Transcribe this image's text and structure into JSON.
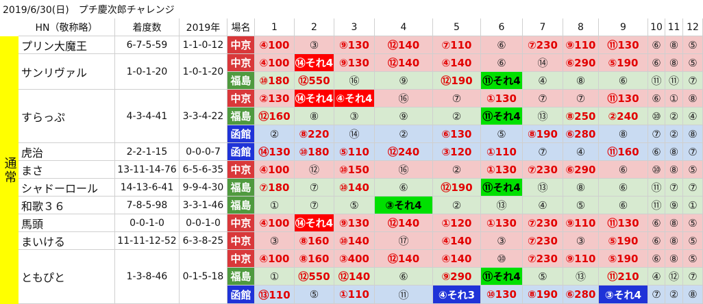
{
  "title": "2019/6/30(日)　プチ慶次郎チャレンジ",
  "group_label": "通常",
  "headers": {
    "hn": "HN（敬称略）",
    "record": "着度数",
    "year": "2019年",
    "venue": "場名",
    "races": [
      "1",
      "2",
      "3",
      "4",
      "5",
      "6",
      "7",
      "8",
      "9",
      "10",
      "11",
      "12"
    ]
  },
  "colors": {
    "chukyo": "#d9383a",
    "fukushima": "#4f9a3f",
    "hakodate": "#1f33d8",
    "highlight_red": "#ff0000",
    "highlight_green": "#00e000",
    "highlight_blue": "#1f33d8",
    "group_yellow": "#ffff00"
  },
  "players": [
    {
      "name": "プリン大魔王",
      "record": "6-7-5-59",
      "year": "1-1-0-12"
    },
    {
      "name": "サンリヴァル",
      "record": "1-0-1-20",
      "year": "1-0-1-20"
    },
    {
      "name": "すらっぷ",
      "record": "4-3-4-41",
      "year": "3-3-4-22"
    },
    {
      "name": "虎治",
      "record": "2-2-1-15",
      "year": "0-0-0-7"
    },
    {
      "name": "まさ",
      "record": "13-11-14-76",
      "year": "6-5-6-35"
    },
    {
      "name": "シャドーロール",
      "record": "14-13-6-41",
      "year": "9-9-4-30"
    },
    {
      "name": "和歌３６",
      "record": "7-8-5-98",
      "year": "3-3-1-46"
    },
    {
      "name": "馬頭",
      "record": "0-0-1-0",
      "year": "0-0-1-0"
    },
    {
      "name": "まいける",
      "record": "11-11-12-52",
      "year": "6-3-8-25"
    },
    {
      "name": "ともぴと",
      "record": "1-3-8-46",
      "year": "0-1-5-18"
    }
  ],
  "rows": [
    {
      "venue": "中京",
      "cells": [
        "④100",
        "③",
        "⑨130",
        "⑫140",
        "⑦110",
        "⑥",
        "⑦230",
        "⑨110",
        "⑪130",
        "⑥",
        "⑧",
        "⑤"
      ]
    },
    {
      "venue": "中京",
      "cells": [
        "④100",
        "⑭それ4",
        "⑨130",
        "⑫140",
        "④140",
        "⑥",
        "⑭",
        "⑥290",
        "⑤190",
        "⑥",
        "⑧",
        "⑤"
      ]
    },
    {
      "venue": "福島",
      "cells": [
        "⑩180",
        "⑫550",
        "⑯",
        "⑨",
        "⑫190",
        "⑪それ4",
        "④",
        "⑧",
        "⑥",
        "⑪",
        "⑪",
        "⑦"
      ]
    },
    {
      "venue": "中京",
      "cells": [
        "②130",
        "⑭それ4",
        "④それ4",
        "⑯",
        "⑦",
        "①130",
        "⑦",
        "⑦",
        "⑪130",
        "⑥",
        "①",
        "⑧"
      ]
    },
    {
      "venue": "福島",
      "cells": [
        "⑫160",
        "⑧",
        "③",
        "⑨",
        "②",
        "⑪それ4",
        "⑬",
        "⑧250",
        "②240",
        "⑩",
        "②",
        "④"
      ]
    },
    {
      "venue": "函館",
      "cells": [
        "②",
        "⑧220",
        "⑭",
        "②",
        "⑥130",
        "⑤",
        "⑧190",
        "⑥280",
        "⑧",
        "⑦",
        "②",
        "⑧"
      ]
    },
    {
      "venue": "函館",
      "cells": [
        "⑭130",
        "⑩180",
        "⑤110",
        "⑫240",
        "③120",
        "①110",
        "⑦",
        "④",
        "⑪160",
        "⑥",
        "⑧",
        "⑦"
      ]
    },
    {
      "venue": "中京",
      "cells": [
        "④100",
        "⑫",
        "⑩150",
        "⑯",
        "②",
        "①130",
        "⑦230",
        "⑥290",
        "⑥",
        "⑩",
        "⑧",
        "⑤"
      ]
    },
    {
      "venue": "福島",
      "cells": [
        "⑦180",
        "⑦",
        "⑩140",
        "⑥",
        "⑫190",
        "⑪それ4",
        "⑬",
        "⑧",
        "⑥",
        "⑪",
        "⑦",
        "⑦"
      ]
    },
    {
      "venue": "福島",
      "cells": [
        "①",
        "⑦",
        "⑤",
        "③それ4",
        "②",
        "⑬",
        "④",
        "⑤",
        "⑥",
        "⑪",
        "⑨",
        "①"
      ]
    },
    {
      "venue": "中京",
      "cells": [
        "④100",
        "⑭それ4",
        "⑨130",
        "⑫140",
        "①120",
        "①130",
        "⑦230",
        "⑨110",
        "⑪130",
        "⑥",
        "⑧",
        "⑤"
      ]
    },
    {
      "venue": "中京",
      "cells": [
        "③",
        "⑧160",
        "⑩140",
        "⑰",
        "④140",
        "③",
        "⑦230",
        "③",
        "⑤190",
        "⑥",
        "⑧",
        "⑤"
      ]
    },
    {
      "venue": "中京",
      "cells": [
        "④100",
        "⑧160",
        "③400",
        "⑫140",
        "④140",
        "⑩",
        "⑦230",
        "⑨110",
        "⑤190",
        "⑥",
        "⑧",
        "⑤"
      ]
    },
    {
      "venue": "福島",
      "cells": [
        "①",
        "⑫550",
        "⑫140",
        "⑥",
        "⑨290",
        "⑪それ4",
        "⑤",
        "⑬",
        "⑪210",
        "④",
        "⑫",
        "⑦"
      ]
    },
    {
      "venue": "函館",
      "cells": [
        "⑬110",
        "⑤",
        "①110",
        "⑪",
        "④それ3",
        "⑩130",
        "⑧190",
        "⑥280",
        "③それ4",
        "⑦",
        "②",
        "⑧"
      ]
    }
  ]
}
